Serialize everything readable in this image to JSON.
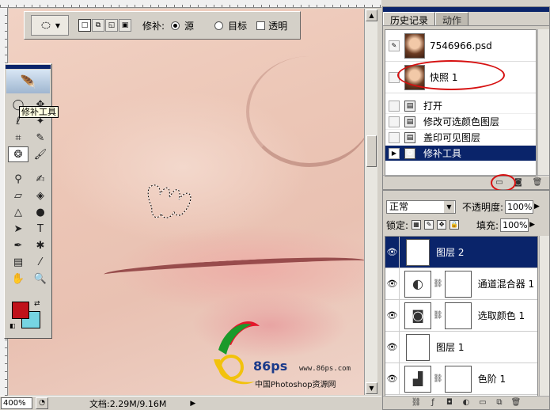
{
  "options_bar": {
    "tool_icon": "patch-tool-icon",
    "patch_label": "修补:",
    "source_label": "源",
    "destination_label": "目标",
    "transparent_label": "透明",
    "selected_mode": "source"
  },
  "toolbox": {
    "tooltip": "修补工具",
    "foreground_color": "#c0111a",
    "background_color": "#76d4e2"
  },
  "status_bar": {
    "zoom": "400%",
    "doc_info": "文档:2.29M/9.16M"
  },
  "history_panel": {
    "tabs": [
      "历史记录",
      "动作"
    ],
    "snapshots": [
      "7546966.psd",
      "快照 1"
    ],
    "states": [
      "打开",
      "修改可选颜色图层",
      "盖印可见图层",
      "修补工具"
    ],
    "selected_state": "修补工具"
  },
  "layers_panel": {
    "blend_mode": "正常",
    "opacity_label": "不透明度:",
    "opacity": "100%",
    "lock_label": "锁定:",
    "fill_label": "填充:",
    "fill": "100%",
    "layers": [
      {
        "name": "图层 2",
        "type": "photo"
      },
      {
        "name": "通道混合器 1",
        "type": "adjustment"
      },
      {
        "name": "选取颜色 1",
        "type": "adjustment"
      },
      {
        "name": "图层 1",
        "type": "photo"
      },
      {
        "name": "色阶 1",
        "type": "adjustment"
      }
    ],
    "selected_layer": "图层 2"
  },
  "watermark": {
    "brand": "86ps",
    "url": "www.86ps.com",
    "site_name": "中国Photoshop资源网"
  }
}
